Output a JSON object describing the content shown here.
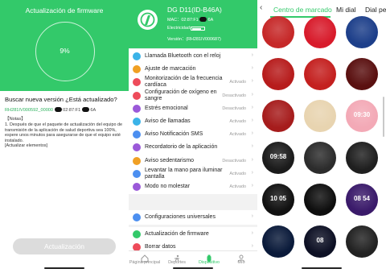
{
  "firmware": {
    "title": "Actualización de firmware",
    "progress_text": "9%",
    "progress": 0.09,
    "question": "Buscar nueva versión ¿Está actualizado?",
    "version_code": "RH281IV000592_00000",
    "version_mac": "02:87:F1",
    "version_mac_tail": "6A",
    "notes_header": "【Notas】",
    "notes_body": "1. Después de que el paquete de actualización del equipo de transmisión de la aplicación de salud deportiva sea 100%, espere unos minutos para asegurarse de que el equipo esté instalado.",
    "notes_footer": "[Actualizar elementos]",
    "update_button": "Actualización"
  },
  "device": {
    "name": "DG D11(ID-B46A)",
    "mac_label": "MAC：02:87:F1",
    "mac_tail": "6A",
    "battery_label": "Electricidad:",
    "battery_level": 0.7,
    "version": "Versión：(RH281IV000687)",
    "menu": [
      {
        "label": "Llamada Bluetooth con el reloj",
        "status": "",
        "icon": "phone-icon",
        "color": "#3bb3e8"
      },
      {
        "label": "Ajuste de marcación",
        "status": "",
        "icon": "dial-icon",
        "color": "#f0a024"
      },
      {
        "label": "Monitorización de la frecuencia cardíaca",
        "status": "Activado",
        "icon": "heart-icon",
        "color": "#ee4b5a"
      },
      {
        "label": "Configuración de oxígeno en sangre",
        "status": "Desactivado",
        "icon": "oxygen-icon",
        "color": "#ee4b5a"
      },
      {
        "label": "Estrés emocional",
        "status": "Desactivado",
        "icon": "emotion-icon",
        "color": "#9b59d9"
      },
      {
        "label": "Aviso de llamadas",
        "status": "Activado",
        "icon": "call-alert-icon",
        "color": "#3bb3e8"
      },
      {
        "label": "Aviso Notificación SMS",
        "status": "Activado",
        "icon": "sms-icon",
        "color": "#4c8ff0"
      },
      {
        "label": "Recordatorio de la aplicación",
        "status": "",
        "icon": "app-reminder-icon",
        "color": "#9b59d9"
      },
      {
        "label": "Aviso sedentarismo",
        "status": "Desactivado",
        "icon": "sedentary-icon",
        "color": "#f0a024"
      },
      {
        "label": "Levantar la mano para iluminar pantalla",
        "status": "Activado",
        "icon": "raise-hand-icon",
        "color": "#4c8ff0"
      },
      {
        "label": "Modo no molestar",
        "status": "Activado",
        "icon": "moon-icon",
        "color": "#9b59d9"
      },
      {
        "label": "Configuraciones universales",
        "status": "",
        "icon": "settings-icon",
        "color": "#4c8ff0"
      },
      {
        "label": "Actualización de firmware",
        "status": "",
        "icon": "firmware-icon",
        "color": "#33c96a"
      },
      {
        "label": "Borrar datos",
        "status": "",
        "icon": "delete-icon",
        "color": "#ee4b5a"
      }
    ],
    "tabs": [
      "Página principal",
      "Deportes",
      "Dispositivo",
      "Mío"
    ]
  },
  "dials": {
    "tabs": [
      "Centro de marcado",
      "Mi dial",
      "Dial per"
    ],
    "faces": [
      {
        "bg": "#c62828",
        "text": ""
      },
      {
        "bg": "#d81b2b",
        "text": ""
      },
      {
        "bg": "#1d3f8a",
        "text": ""
      },
      {
        "bg": "#b71c1c",
        "text": ""
      },
      {
        "bg": "#c4201f",
        "text": ""
      },
      {
        "bg": "#5a1010",
        "text": ""
      },
      {
        "bg": "#a61c1c",
        "text": ""
      },
      {
        "bg": "#e8d4b0",
        "text": ""
      },
      {
        "bg": "#f3a9b6",
        "text": "09:30"
      },
      {
        "bg": "#1b1b1b",
        "text": "09:58"
      },
      {
        "bg": "#2c2c2c",
        "text": ""
      },
      {
        "bg": "#1f1f1f",
        "text": ""
      },
      {
        "bg": "#111111",
        "text": "10 05"
      },
      {
        "bg": "#0e0e0e",
        "text": ""
      },
      {
        "bg": "#3a1a6a",
        "text": "08 54"
      },
      {
        "bg": "#0a1a3a",
        "text": ""
      },
      {
        "bg": "#0d1024",
        "text": "08"
      },
      {
        "bg": "#222222",
        "text": ""
      }
    ]
  }
}
